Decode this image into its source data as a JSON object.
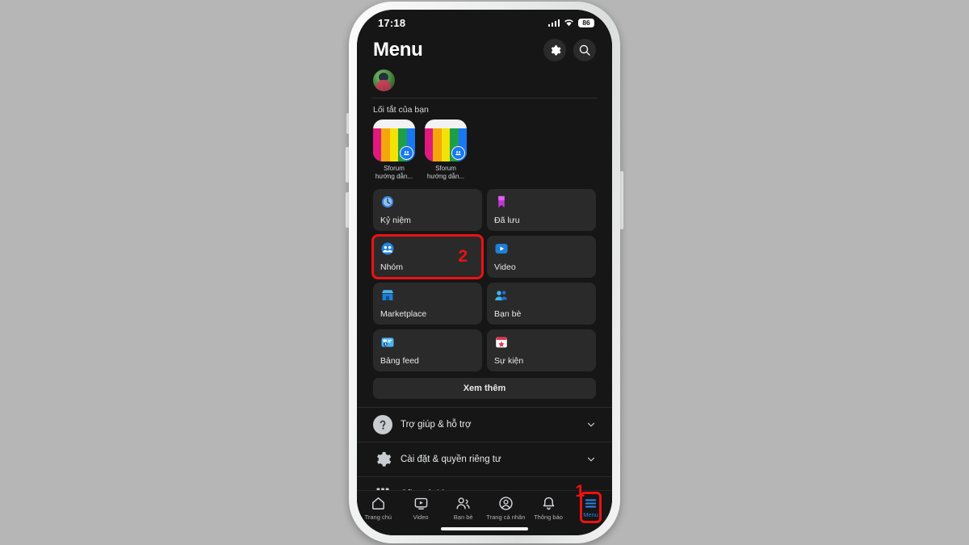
{
  "status_bar": {
    "time": "17:18",
    "battery": "86",
    "signal_icon": "cellular-signal-icon",
    "wifi_icon": "wifi-icon"
  },
  "header": {
    "title": "Menu",
    "settings_icon": "gear-icon",
    "search_icon": "search-icon"
  },
  "account": {
    "avatar_name": "profile-avatar"
  },
  "shortcuts": {
    "label": "Lối tắt của bạn",
    "items": [
      {
        "title": "Sforum",
        "subtitle": "hướng dẫn..."
      },
      {
        "title": "Sforum",
        "subtitle": "hướng dẫn..."
      }
    ]
  },
  "tiles": [
    {
      "label": "Kỷ niệm",
      "icon": "clock-icon",
      "highlighted": false
    },
    {
      "label": "Đã lưu",
      "icon": "bookmark-icon",
      "highlighted": false
    },
    {
      "label": "Nhóm",
      "icon": "groups-icon",
      "highlighted": true,
      "step": "2"
    },
    {
      "label": "Video",
      "icon": "video-play-icon",
      "highlighted": false
    },
    {
      "label": "Marketplace",
      "icon": "storefront-icon",
      "highlighted": false
    },
    {
      "label": "Bạn bè",
      "icon": "friends-icon",
      "highlighted": false
    },
    {
      "label": "Bảng feed",
      "icon": "feed-card-icon",
      "highlighted": false
    },
    {
      "label": "Sự kiện",
      "icon": "calendar-icon",
      "highlighted": false
    }
  ],
  "see_more": {
    "label": "Xem thêm"
  },
  "rows": [
    {
      "label": "Trợ giúp & hỗ trợ",
      "icon": "question-mark-icon",
      "chevron": "chevron-down-icon"
    },
    {
      "label": "Cài đặt & quyền riêng tư",
      "icon": "gear-icon",
      "chevron": "chevron-down-icon"
    },
    {
      "label": "Cũng từ Meta",
      "icon": "grid-dots-icon",
      "chevron": "chevron-up-icon"
    }
  ],
  "bottom_nav": {
    "items": [
      {
        "label": "Trang chủ",
        "icon": "home-icon",
        "active": false
      },
      {
        "label": "Video",
        "icon": "video-icon",
        "active": false
      },
      {
        "label": "Bạn bè",
        "icon": "friends-icon",
        "active": false
      },
      {
        "label": "Trang cá nhân",
        "icon": "profile-icon",
        "active": false
      },
      {
        "label": "Thông báo",
        "icon": "bell-icon",
        "active": false
      },
      {
        "label": "Menu",
        "icon": "hamburger-icon",
        "active": true,
        "step": "1"
      }
    ]
  },
  "colors": {
    "accent": "#2a7fe8",
    "annotation": "#ee1111",
    "screen_bg": "#161616",
    "tile_bg": "#2a2a2a",
    "page_bg": "#b6b6b6"
  }
}
